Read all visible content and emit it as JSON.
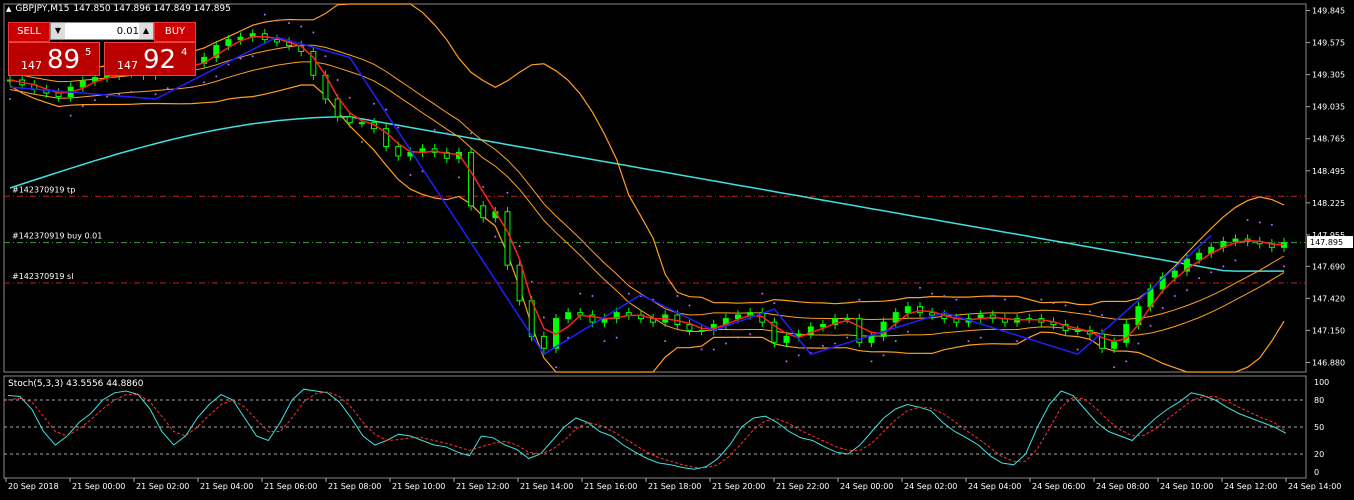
{
  "header": {
    "symbol": "GBPJPY,M15",
    "ohlc": "147.850 147.896 147.849 147.895"
  },
  "trade_panel": {
    "sell_label": "SELL",
    "buy_label": "BUY",
    "lot": "0.01",
    "sell_price": {
      "prefix": "147",
      "main": "89",
      "sup": "5"
    },
    "buy_price": {
      "prefix": "147",
      "main": "92",
      "sup": "4"
    }
  },
  "stoch_label": "Stoch(5,3,3) 43.5556 44.8860",
  "colors": {
    "background": "#000000",
    "bull": "#00ff00",
    "bear": "#000000",
    "ma_cyan": "#40e0e0",
    "ma_red": "#ff2020",
    "bands": "#ffa020",
    "zigzag": "#2020ff",
    "psar": "#c060ff",
    "level_red": "#c02020",
    "level_green": "#40a040",
    "stoch_main": "#40e0e0",
    "stoch_signal": "#ff3030"
  },
  "chart_data": [
    {
      "type": "candlestick",
      "title": "GBPJPY,M15",
      "ylim": [
        146.8,
        149.9
      ],
      "y_ticks": [
        149.845,
        149.575,
        149.305,
        149.035,
        148.765,
        148.495,
        148.225,
        147.955,
        147.69,
        147.42,
        147.15,
        146.88
      ],
      "current_price": 147.895,
      "x_ticks": [
        "20 Sep 2018",
        "21 Sep 00:00",
        "21 Sep 02:00",
        "21 Sep 04:00",
        "21 Sep 06:00",
        "21 Sep 08:00",
        "21 Sep 10:00",
        "21 Sep 12:00",
        "21 Sep 14:00",
        "21 Sep 16:00",
        "21 Sep 18:00",
        "21 Sep 20:00",
        "21 Sep 22:00",
        "24 Sep 00:00",
        "24 Sep 02:00",
        "24 Sep 04:00",
        "24 Sep 06:00",
        "24 Sep 08:00",
        "24 Sep 10:00",
        "24 Sep 12:00",
        "24 Sep 14:00"
      ],
      "levels": [
        {
          "label": "#142370919 tp",
          "price": 148.28,
          "style": "red"
        },
        {
          "label": "#142370919 buy 0.01",
          "price": 147.89,
          "style": "green"
        },
        {
          "label": "#142370919 sl",
          "price": 147.55,
          "style": "red"
        }
      ],
      "close_series": [
        149.26,
        149.22,
        149.18,
        149.15,
        149.12,
        149.2,
        149.25,
        149.28,
        149.3,
        149.32,
        149.33,
        149.3,
        149.35,
        149.38,
        149.36,
        149.4,
        149.45,
        149.55,
        149.6,
        149.62,
        149.65,
        149.6,
        149.58,
        149.55,
        149.5,
        149.3,
        149.1,
        148.95,
        148.9,
        148.9,
        148.85,
        148.7,
        148.62,
        148.65,
        148.68,
        148.65,
        148.6,
        148.65,
        148.2,
        148.1,
        148.15,
        147.7,
        147.4,
        147.1,
        147.0,
        147.25,
        147.3,
        147.28,
        147.22,
        147.25,
        147.3,
        147.28,
        147.25,
        147.22,
        147.28,
        147.2,
        147.15,
        147.15,
        147.2,
        147.25,
        147.28,
        147.3,
        147.22,
        147.05,
        147.1,
        147.12,
        147.18,
        147.2,
        147.25,
        147.25,
        147.05,
        147.1,
        147.22,
        147.3,
        147.35,
        147.3,
        147.28,
        147.25,
        147.22,
        147.25,
        147.28,
        147.25,
        147.22,
        147.25,
        147.25,
        147.22,
        147.2,
        147.15,
        147.15,
        147.12,
        147.0,
        147.05,
        147.2,
        147.35,
        147.5,
        147.6,
        147.65,
        147.75,
        147.8,
        147.85,
        147.9,
        147.92,
        147.9,
        147.88,
        147.85,
        147.89
      ],
      "zigzag": [
        [
          0,
          149.2
        ],
        [
          12,
          149.1
        ],
        [
          22,
          149.62
        ],
        [
          28,
          149.45
        ],
        [
          44,
          146.95
        ],
        [
          52,
          147.45
        ],
        [
          58,
          147.15
        ],
        [
          63,
          147.33
        ],
        [
          66,
          146.95
        ],
        [
          77,
          147.3
        ],
        [
          88,
          146.95
        ],
        [
          99,
          147.95
        ]
      ]
    },
    {
      "type": "line",
      "title": "Stoch(5,3,3) 43.5556 44.8860",
      "ylim": [
        0,
        100
      ],
      "y_ticks": [
        100,
        80,
        50,
        20,
        0
      ],
      "levels": [
        80,
        50,
        20
      ],
      "series": [
        {
          "name": "main",
          "values": [
            85,
            84,
            70,
            45,
            30,
            40,
            55,
            65,
            80,
            88,
            90,
            86,
            70,
            45,
            30,
            40,
            60,
            75,
            86,
            80,
            60,
            40,
            35,
            55,
            80,
            92,
            90,
            88,
            78,
            60,
            40,
            30,
            35,
            42,
            40,
            35,
            30,
            28,
            22,
            18,
            40,
            38,
            30,
            25,
            15,
            20,
            35,
            50,
            60,
            55,
            45,
            40,
            30,
            22,
            15,
            10,
            8,
            5,
            3,
            6,
            15,
            30,
            50,
            60,
            62,
            55,
            45,
            38,
            35,
            28,
            22,
            20,
            30,
            45,
            60,
            70,
            75,
            72,
            68,
            55,
            45,
            38,
            30,
            18,
            10,
            8,
            20,
            50,
            75,
            90,
            85,
            70,
            55,
            45,
            40,
            35,
            48,
            60,
            70,
            78,
            88,
            85,
            80,
            72,
            65,
            60,
            55,
            50,
            43
          ]
        },
        {
          "name": "signal",
          "values": [
            80,
            82,
            78,
            62,
            45,
            40,
            48,
            58,
            70,
            80,
            86,
            86,
            78,
            62,
            45,
            40,
            50,
            63,
            75,
            80,
            72,
            58,
            45,
            45,
            60,
            78,
            87,
            89,
            84,
            72,
            55,
            42,
            35,
            36,
            38,
            38,
            35,
            32,
            28,
            24,
            28,
            32,
            34,
            30,
            22,
            20,
            25,
            35,
            48,
            55,
            52,
            46,
            38,
            30,
            22,
            16,
            12,
            8,
            5,
            5,
            8,
            18,
            32,
            47,
            57,
            59,
            54,
            46,
            40,
            34,
            28,
            24,
            24,
            32,
            45,
            58,
            68,
            72,
            71,
            65,
            56,
            46,
            37,
            27,
            17,
            12,
            12,
            26,
            48,
            72,
            83,
            81,
            70,
            57,
            47,
            40,
            41,
            48,
            59,
            69,
            79,
            84,
            84,
            79,
            72,
            66,
            60,
            55,
            45
          ]
        }
      ],
      "x_ticks": [
        "20 Sep 2018",
        "21 Sep 00:00",
        "21 Sep 02:00",
        "21 Sep 04:00",
        "21 Sep 06:00",
        "21 Sep 08:00",
        "21 Sep 10:00",
        "21 Sep 12:00",
        "21 Sep 14:00",
        "21 Sep 16:00",
        "21 Sep 18:00",
        "21 Sep 20:00",
        "21 Sep 22:00",
        "24 Sep 00:00",
        "24 Sep 02:00",
        "24 Sep 04:00",
        "24 Sep 06:00",
        "24 Sep 08:00",
        "24 Sep 10:00",
        "24 Sep 12:00",
        "24 Sep 14:00"
      ]
    }
  ]
}
